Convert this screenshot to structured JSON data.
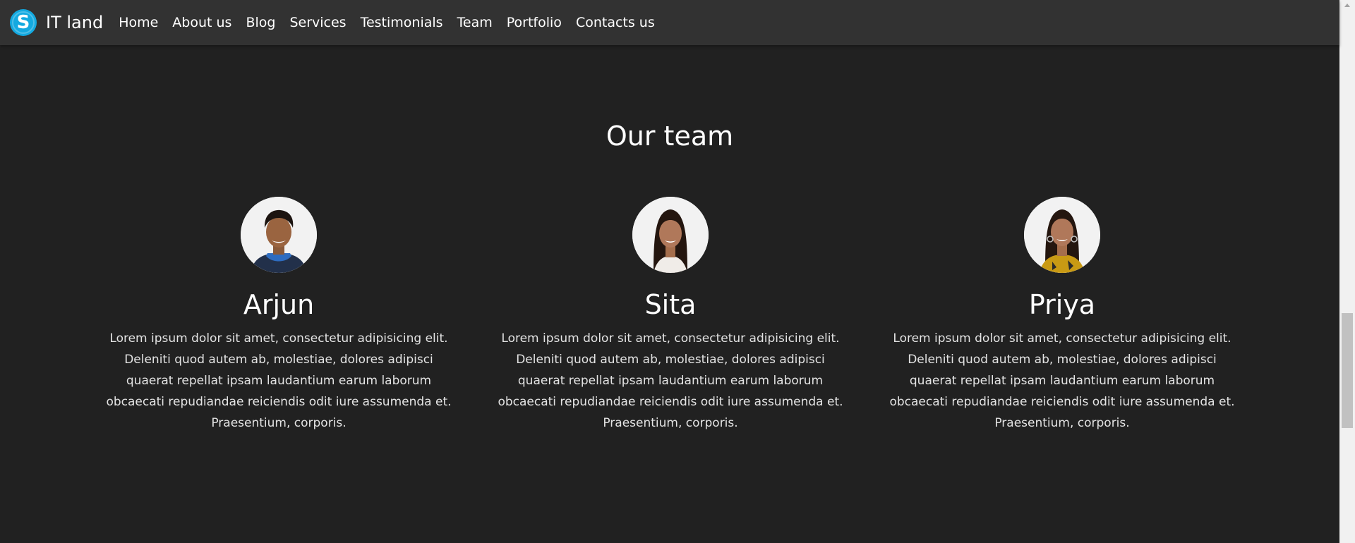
{
  "brand": {
    "logo_letter": "S",
    "name": "IT land",
    "color": "#13a9e0"
  },
  "nav": {
    "items": [
      {
        "label": "Home"
      },
      {
        "label": "About us"
      },
      {
        "label": "Blog"
      },
      {
        "label": "Services"
      },
      {
        "label": "Testimonials"
      },
      {
        "label": "Team"
      },
      {
        "label": "Portfolio"
      },
      {
        "label": "Contacts us"
      }
    ]
  },
  "team": {
    "title": "Our team",
    "members": [
      {
        "name": "Arjun",
        "bio": "Lorem ipsum dolor sit amet, consectetur adipisicing elit. Deleniti quod autem ab, molestiae, dolores adipisci quaerat repellat ipsam laudantium earum laborum obcaecati repudiandae reiciendis odit iure assumenda et. Praesentium, corporis."
      },
      {
        "name": "Sita",
        "bio": "Lorem ipsum dolor sit amet, consectetur adipisicing elit. Deleniti quod autem ab, molestiae, dolores adipisci quaerat repellat ipsam laudantium earum laborum obcaecati repudiandae reiciendis odit iure assumenda et. Praesentium, corporis."
      },
      {
        "name": "Priya",
        "bio": "Lorem ipsum dolor sit amet, consectetur adipisicing elit. Deleniti quod autem ab, molestiae, dolores adipisci quaerat repellat ipsam laudantium earum laborum obcaecati repudiandae reiciendis odit iure assumenda et. Praesentium, corporis."
      }
    ]
  },
  "colors": {
    "page_background": "#212121",
    "navbar_background": "#323232",
    "text": "#ffffff"
  }
}
